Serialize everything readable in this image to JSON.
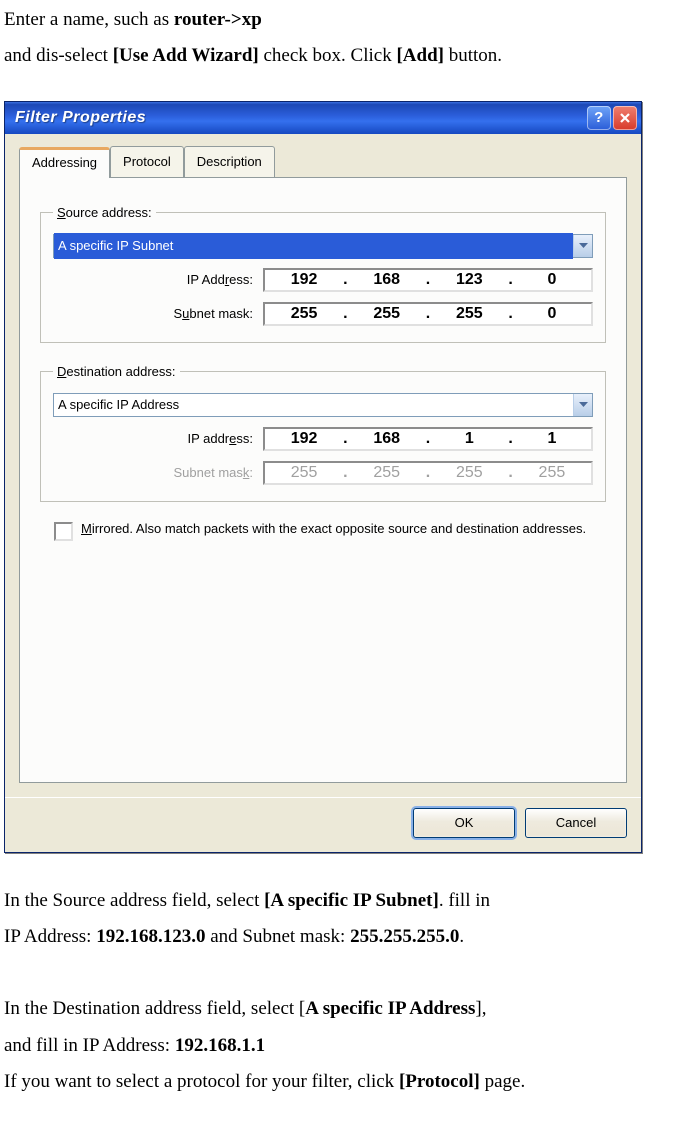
{
  "doc": {
    "line1a": "Enter a name, such as ",
    "line1b": "router->xp",
    "line2a": "and dis-select ",
    "line2b": "[Use Add Wizard]",
    "line2c": " check box. Click ",
    "line2d": "[Add]",
    "line2e": " button.",
    "post1a": "In the Source address field, select ",
    "post1b": "[A specific IP Subnet]",
    "post1c": ". fill in",
    "post2a": "IP Address: ",
    "post2b": "192.168.123.0",
    "post2c": " and Subnet mask: ",
    "post2d": "255.255.255.0",
    "post2e": ".",
    "post3a": "In the Destination address field, select [",
    "post3b": "A specific IP Address",
    "post3c": "],",
    "post4a": "and fill in IP Address: ",
    "post4b": "192.168.1.1",
    "post5a": "If you want to select a protocol for your filter, click ",
    "post5b": "[Protocol]",
    "post5c": " page."
  },
  "dialog": {
    "title": "Filter Properties",
    "tabs": {
      "addressing": "Addressing",
      "protocol": "Protocol",
      "description": "Description"
    },
    "source": {
      "legend_pre": "S",
      "legend_rest": "ource address:",
      "select": "A specific IP Subnet",
      "ip_label_pre": "IP Add",
      "ip_label_u": "r",
      "ip_label_post": "ess:",
      "ip": [
        "192",
        "168",
        "123",
        "0"
      ],
      "mask_label_pre": "S",
      "mask_label_u": "u",
      "mask_label_post": "bnet mask:",
      "mask": [
        "255",
        "255",
        "255",
        "0"
      ]
    },
    "dest": {
      "legend_pre": "D",
      "legend_rest": "estination address:",
      "select": "A specific IP Address",
      "ip_label_pre": "IP addr",
      "ip_label_u": "e",
      "ip_label_post": "ss:",
      "ip": [
        "192",
        "168",
        "1",
        "1"
      ],
      "mask_label_pre": "Subnet mas",
      "mask_label_u": "k",
      "mask_label_post": ":",
      "mask": [
        "255",
        "255",
        "255",
        "255"
      ]
    },
    "mirrored": {
      "label_pre": "M",
      "label_rest": "irrored. Also match packets with the exact opposite source and destination addresses."
    },
    "ok": "OK",
    "cancel": "Cancel"
  }
}
